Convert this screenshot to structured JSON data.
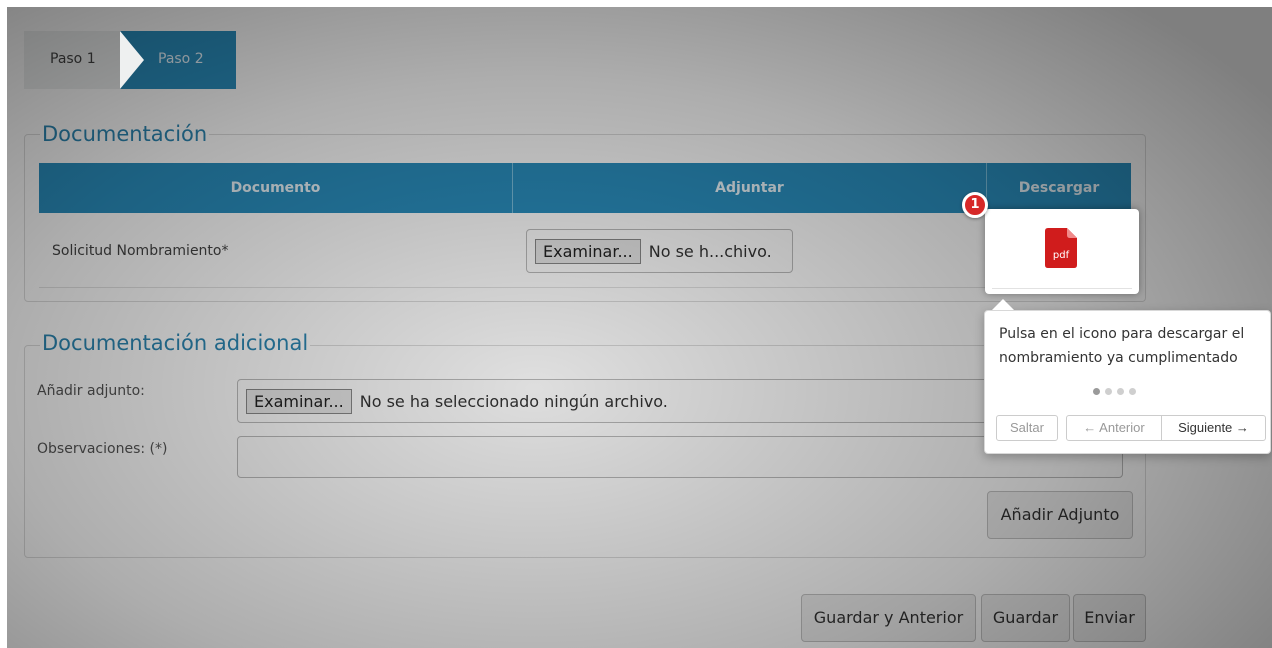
{
  "steps": [
    {
      "label": "Paso 1"
    },
    {
      "label": "Paso 2"
    }
  ],
  "documentacion": {
    "legend": "Documentación",
    "columns": [
      "Documento",
      "Adjuntar",
      "Descargar"
    ],
    "rows": [
      {
        "documento": "Solicitud Nombramiento*",
        "browse_label": "Examinar...",
        "file_text": "No se h...chivo."
      }
    ]
  },
  "adicional": {
    "legend": "Documentación adicional",
    "adjunto_label": "Añadir adjunto:",
    "browse_label": "Examinar...",
    "file_text": "No se ha seleccionado ningún archivo.",
    "observaciones_label": "Observaciones: (*)",
    "observaciones_value": "",
    "add_button": "Añadir Adjunto"
  },
  "actions": {
    "guardar_anterior": "Guardar y Anterior",
    "guardar": "Guardar",
    "enviar": "Enviar"
  },
  "tour": {
    "step_number": "1",
    "icon_label": "pdf",
    "text": "Pulsa en el icono para descargar el nombramiento ya cumplimentado",
    "total_steps": 4,
    "current_step": 1,
    "skip": "Saltar",
    "prev": "← Anterior",
    "next": "Siguiente →"
  },
  "colors": {
    "accent": "#2a8fbf",
    "legend": "#2c87b3",
    "badge": "#d62828",
    "pdf": "#d01c1c"
  }
}
